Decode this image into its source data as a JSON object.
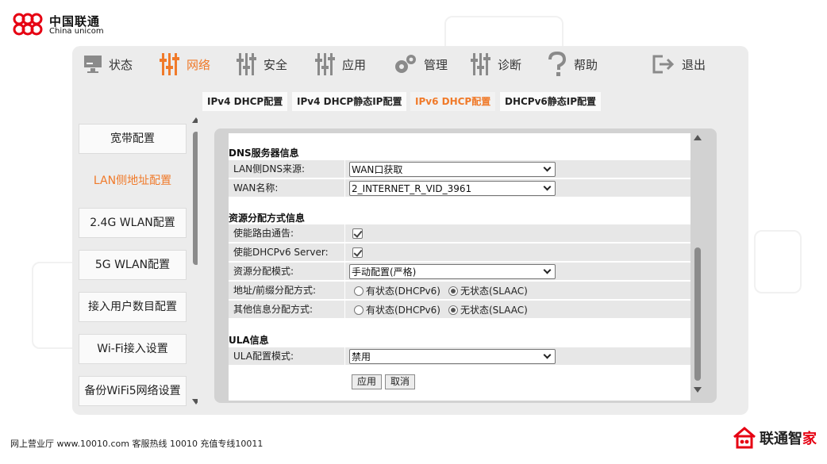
{
  "brand": {
    "cn": "中国联通",
    "en": "China unicom"
  },
  "nav": [
    {
      "label": "状态",
      "icon": "monitor-icon"
    },
    {
      "label": "网络",
      "icon": "sliders-icon",
      "active": true
    },
    {
      "label": "安全",
      "icon": "sliders-icon"
    },
    {
      "label": "应用",
      "icon": "sliders-icon"
    },
    {
      "label": "管理",
      "icon": "gears-icon"
    },
    {
      "label": "诊断",
      "icon": "sliders-icon"
    },
    {
      "label": "帮助",
      "icon": "question-icon"
    },
    {
      "label": "退出",
      "icon": "logout-icon"
    }
  ],
  "subtabs": [
    {
      "label": "IPv4 DHCP配置"
    },
    {
      "label": "IPv4 DHCP静态IP配置"
    },
    {
      "label": "IPv6 DHCP配置",
      "active": true
    },
    {
      "label": "DHCPv6静态IP配置"
    }
  ],
  "sidebar": [
    {
      "label": "宽带配置"
    },
    {
      "label": "LAN侧地址配置",
      "active": true
    },
    {
      "label": "2.4G WLAN配置"
    },
    {
      "label": "5G WLAN配置"
    },
    {
      "label": "接入用户数目配置"
    },
    {
      "label": "Wi-Fi接入设置"
    },
    {
      "label": "备份WiFi5网络设置"
    }
  ],
  "dns": {
    "title": "DNS服务器信息",
    "source_label": "LAN侧DNS来源:",
    "source_value": "WAN口获取",
    "wan_label": "WAN名称:",
    "wan_value": "2_INTERNET_R_VID_3961"
  },
  "alloc": {
    "title": "资源分配方式信息",
    "ra_label": "使能路由通告:",
    "ra_checked": true,
    "dhcp_label": "使能DHCPv6 Server:",
    "dhcp_checked": true,
    "mode_label": "资源分配模式:",
    "mode_value": "手动配置(严格)",
    "addr_label": "地址/前缀分配方式:",
    "other_label": "其他信息分配方式:",
    "stateful": "有状态(DHCPv6)",
    "stateless": "无状态(SLAAC)"
  },
  "ula": {
    "title": "ULA信息",
    "mode_label": "ULA配置模式:",
    "mode_value": "禁用"
  },
  "buttons": {
    "apply": "应用",
    "cancel": "取消"
  },
  "footer": {
    "info": "网上营业厅 www.10010.com  客服热线  10010  充值专线10011",
    "brand_main": "联通智",
    "brand_accent": "家"
  },
  "colors": {
    "accent": "#f07a2a",
    "brand_red": "#e60012"
  }
}
